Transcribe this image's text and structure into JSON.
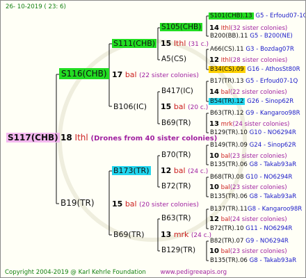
{
  "header": {
    "date": "26- 10-2019 ( 23:  6)"
  },
  "footer": {
    "copyright": "Copyright 2004-2019 @ Karl Kehrle Foundation",
    "site": "www.pedigreeapis.org"
  },
  "colors": {
    "green_box": "#22dd22",
    "yellow_box": "#ffd100",
    "cyan_box": "#22d5ee",
    "pink_box": "#f4b8f0",
    "link_blue": "#1a1ac8",
    "mating_red": "#cc2020"
  },
  "root": {
    "id": "S117(CHB)",
    "num": "18",
    "mating": "Ithl",
    "note": "(Drones from 40 sister colonies)"
  },
  "gen1": {
    "a": {
      "id": "S116(CHB)",
      "num": "17",
      "mating": "bal",
      "note": "(22 sister colonies)"
    },
    "b": {
      "id": "B19(TR)",
      "num": "15",
      "mating": "bal",
      "note": "(20 sister colonies)"
    }
  },
  "gen2": {
    "a": {
      "id": "S111(CHB)",
      "num": "15",
      "mating": "Ithl",
      "note": "(31 c.)"
    },
    "b": {
      "id": "B106(IC)",
      "num": "15",
      "mating": "bal",
      "note": "(20 c.)"
    },
    "c": {
      "id": "B173(TR)",
      "num": "12",
      "mating": "bal",
      "note": "(24 c.)"
    },
    "d": {
      "id": "B69(TR)",
      "num": "13",
      "mating": "mrk",
      "note": "(24 c.)"
    }
  },
  "gen3": [
    {
      "id": "S105(CHB)",
      "num": "14",
      "mating": "Ithl",
      "note": "(32 sister colonies)"
    },
    {
      "id": "A5(CS)",
      "num": "12",
      "mating": "Ithl",
      "note": "(28 sister colonies)"
    },
    {
      "id": "B417(IC)",
      "num": "14",
      "mating": "bal",
      "note": "(22 sister colonies)"
    },
    {
      "id": "B69(TR)",
      "num": "13",
      "mating": "mrk",
      "note": "(24 sister colonies)"
    },
    {
      "id": "B70(TR)",
      "num": "10",
      "mating": "bal",
      "note": "(23 sister colonies)"
    },
    {
      "id": "B72(TR)",
      "num": "10",
      "mating": "bal",
      "note": "(23 sister colonies)"
    },
    {
      "id": "B63(TR)",
      "num": "12",
      "mating": "bal",
      "note": "(24 sister colonies)"
    },
    {
      "id": "B129(TR)",
      "num": "10",
      "mating": "bal",
      "note": "(23 sister colonies)"
    }
  ],
  "gen4": [
    {
      "id": "S101(CHB).13",
      "ref": "G5 - Erfoud07-1Q"
    },
    {
      "id": "B200(BB).11",
      "ref": "G5 - B200(NE)"
    },
    {
      "id": "A66(CS).11",
      "ref": "G3 - Bozdag07R"
    },
    {
      "id": "B34(CS).09",
      "ref": "G16 - AthosSt80R"
    },
    {
      "id": "B17(TR).13",
      "ref": "G5 - Erfoud07-1Q"
    },
    {
      "id": "B54(TR).12",
      "ref": "G26 - Sinop62R"
    },
    {
      "id": "B63(TR).12",
      "ref": "G9 - Kangaroo98R"
    },
    {
      "id": "B129(TR).10",
      "ref": "G10 - NO6294R"
    },
    {
      "id": "B149(TR).09",
      "ref": "G24 - Sinop62R"
    },
    {
      "id": "B135(TR).06",
      "ref": "G8 - Takab93aR"
    },
    {
      "id": "B68(TR).08",
      "ref": "G10 - NO6294R"
    },
    {
      "id": "B135(TR).06",
      "ref": "G8 - Takab93aR"
    },
    {
      "id": "B137(TR).11",
      "ref": "G8 - Kangaroo98R"
    },
    {
      "id": "B72(TR).10",
      "ref": "G11 - NO6294R"
    },
    {
      "id": "B82(TR).07",
      "ref": "G9 - NO6294R"
    },
    {
      "id": "B135(TR).06",
      "ref": "G8 - Takab93aR"
    }
  ]
}
